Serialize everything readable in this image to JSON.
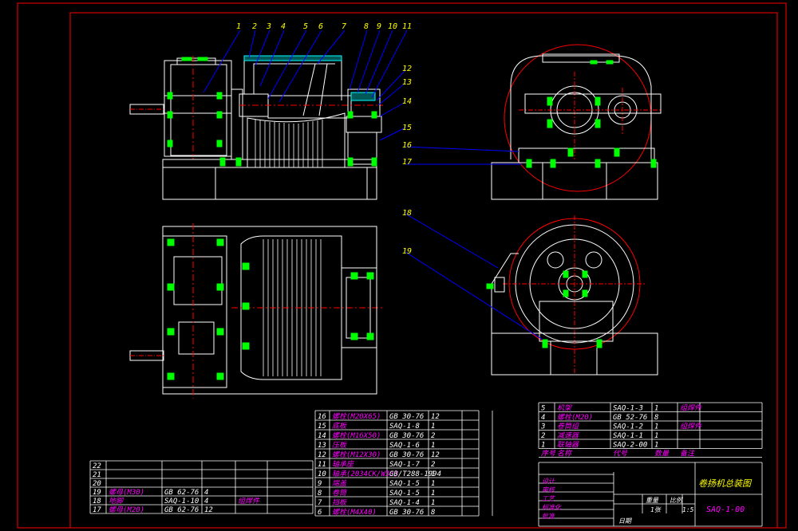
{
  "colors": {
    "background": "#000000",
    "outline": "#ffffff",
    "frame": "#ff0000",
    "leader": "#0000ff",
    "bolt": "#00ff00",
    "label": "#ffff00",
    "text_cn": "#ff00ff",
    "hatch": "#00ffff"
  },
  "callouts": [
    "1",
    "2",
    "3",
    "4",
    "5",
    "6",
    "7",
    "8",
    "9",
    "10",
    "11",
    "12",
    "13",
    "14",
    "15",
    "16",
    "17",
    "18",
    "19"
  ],
  "parts_right": {
    "rows": [
      {
        "no": "5",
        "name": "机架",
        "code": "SAQ-1-3",
        "qty": "1",
        "note": "组焊件"
      },
      {
        "no": "4",
        "name": "螺栓(M20)",
        "code": "GB 52-76",
        "qty": "8",
        "note": ""
      },
      {
        "no": "3",
        "name": "卷筒组",
        "code": "SAQ-1-2",
        "qty": "1",
        "note": "组焊件"
      },
      {
        "no": "2",
        "name": "减速器",
        "code": "SAQ-1-1",
        "qty": "1",
        "note": ""
      },
      {
        "no": "1",
        "name": "联轴器",
        "code": "SAQ-2-00",
        "qty": "1",
        "note": ""
      }
    ],
    "header": {
      "no": "序号",
      "name": "名称",
      "code": "代号",
      "qty": "数量",
      "note": "备注"
    }
  },
  "parts_middle": {
    "rows": [
      {
        "no": "16",
        "name": "螺栓(M20X65)",
        "code": "GB 30-76",
        "qty": "12",
        "note": ""
      },
      {
        "no": "15",
        "name": "底板",
        "code": "SAQ-1-8",
        "qty": "1",
        "note": ""
      },
      {
        "no": "14",
        "name": "螺栓(M16X50)",
        "code": "GB 30-76",
        "qty": "2",
        "note": ""
      },
      {
        "no": "13",
        "name": "压板",
        "code": "SAQ-1-6",
        "qty": "1",
        "note": ""
      },
      {
        "no": "12",
        "name": "螺栓(M12X30)",
        "code": "GB 30-76",
        "qty": "12",
        "note": ""
      },
      {
        "no": "11",
        "name": "轴承座",
        "code": "SAQ-1-7",
        "qty": "2",
        "note": ""
      },
      {
        "no": "10",
        "name": "轴承(2034CK/W33)",
        "code": "GB/T288-1994",
        "qty": "1",
        "note": ""
      },
      {
        "no": "9",
        "name": "端盖",
        "code": "SAQ-1-5",
        "qty": "1",
        "note": ""
      },
      {
        "no": "8",
        "name": "卷筒",
        "code": "SAQ-1-5",
        "qty": "1",
        "note": ""
      },
      {
        "no": "7",
        "name": "挡板",
        "code": "SAQ-1-4",
        "qty": "1",
        "note": ""
      },
      {
        "no": "6",
        "name": "螺栓(M4X40)",
        "code": "GB 30-76",
        "qty": "8",
        "note": ""
      }
    ]
  },
  "parts_left": {
    "rows": [
      {
        "no": "22",
        "name": "",
        "code": "",
        "qty": "",
        "note": ""
      },
      {
        "no": "21",
        "name": "",
        "code": "",
        "qty": "",
        "note": ""
      },
      {
        "no": "20",
        "name": "",
        "code": "",
        "qty": "",
        "note": ""
      },
      {
        "no": "19",
        "name": "螺母(M30)",
        "code": "GB 62-76",
        "qty": "4",
        "note": ""
      },
      {
        "no": "18",
        "name": "地脚",
        "code": "SAQ-1-10",
        "qty": "4",
        "note": "组焊件"
      },
      {
        "no": "17",
        "name": "螺母(M20)",
        "code": "GB 62-76",
        "qty": "12",
        "note": ""
      }
    ]
  },
  "title_block": {
    "title": "卷扬机总装图",
    "drawing_no": "SAQ-1-00",
    "scale_label": "比例",
    "scale": "1:5",
    "sheet": "1张",
    "rows_left": [
      "设计",
      "审核",
      "工艺",
      "标准化",
      "批准"
    ],
    "weight_label": "重量",
    "qty_label": "数量",
    "date": "日期"
  }
}
